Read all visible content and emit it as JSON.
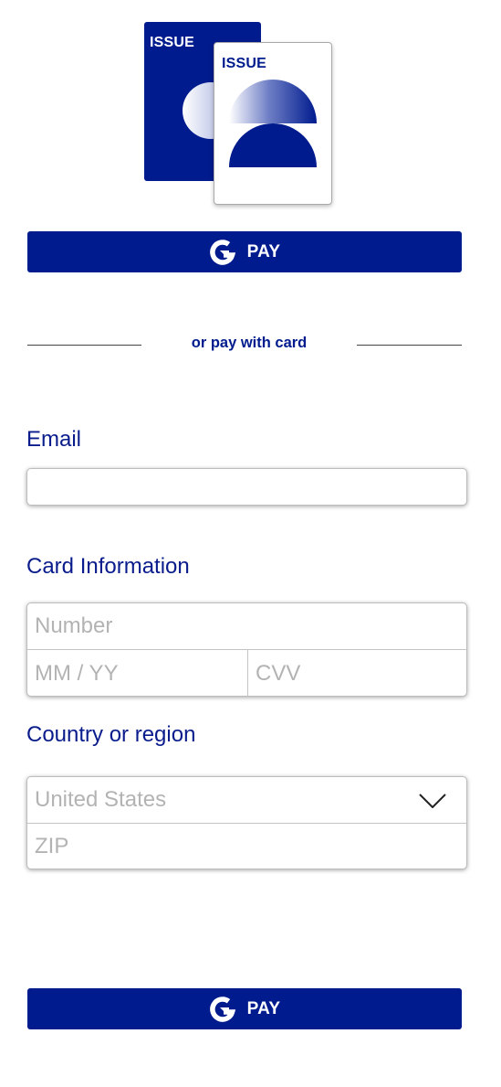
{
  "illustration": {
    "back_cover_title": "ISSUE",
    "front_cover_title": "ISSUE"
  },
  "pay_button_top": {
    "label": "PAY",
    "icon": "g-logo-icon"
  },
  "divider": {
    "text": "or pay with card"
  },
  "email": {
    "label": "Email",
    "value": "",
    "placeholder": ""
  },
  "card": {
    "label": "Card Information",
    "number_placeholder": "Number",
    "expiry_placeholder": "MM / YY",
    "cvv_placeholder": "CVV"
  },
  "region": {
    "label": "Country or region",
    "selected_country": "United States",
    "zip_placeholder": "ZIP"
  },
  "pay_button_bottom": {
    "label": "PAY",
    "icon": "g-logo-icon"
  },
  "colors": {
    "brand": "#001b8e",
    "label_text": "#0a1c8c",
    "placeholder": "#b3b3b3",
    "background": "#ffffff"
  }
}
